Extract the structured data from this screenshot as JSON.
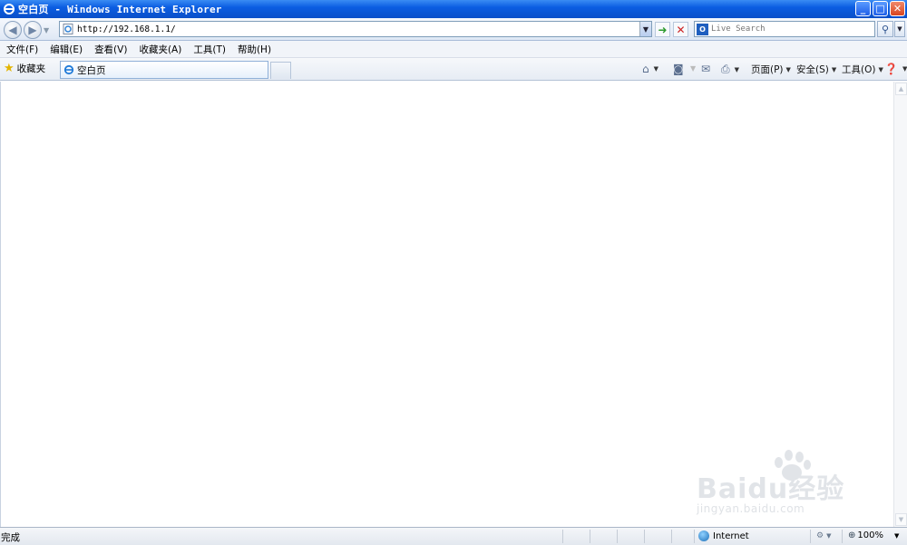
{
  "window": {
    "title": "空白页 - Windows Internet Explorer",
    "controls": {
      "minimize": "_",
      "maximize": "□",
      "close": "✕"
    }
  },
  "address_bar": {
    "url": "http://192.168.1.1/",
    "search_placeholder": "Live Search"
  },
  "menu": {
    "items": [
      "文件(F)",
      "编辑(E)",
      "查看(V)",
      "收藏夹(A)",
      "工具(T)",
      "帮助(H)"
    ]
  },
  "favorites": {
    "label": "收藏夹"
  },
  "tabs": [
    {
      "label": "空白页",
      "active": true
    }
  ],
  "command_bar": {
    "page_label": "页面(P)",
    "safety_label": "安全(S)",
    "tools_label": "工具(O)"
  },
  "status_bar": {
    "status_text": "完成",
    "zone": "Internet",
    "zoom": "100%"
  },
  "watermark": {
    "main": "Baidu经验",
    "sub": "jingyan.baidu.com"
  },
  "colors": {
    "titlebar": "#0b5de2",
    "go_arrow": "#2e9b2e",
    "stop": "#cc2222"
  }
}
